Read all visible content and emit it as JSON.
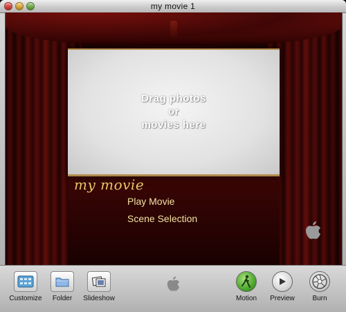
{
  "window": {
    "title": "my movie 1"
  },
  "stage": {
    "drop_zone_lines": [
      "Drag photos",
      "or",
      "movies here"
    ],
    "menu_title": "my movie",
    "menu_items": [
      "Play Movie",
      "Scene Selection"
    ]
  },
  "toolbar": {
    "buttons": [
      {
        "label": "Customize",
        "icon": "customize-icon"
      },
      {
        "label": "Folder",
        "icon": "folder-icon"
      },
      {
        "label": "Slideshow",
        "icon": "slideshow-icon"
      },
      {
        "label": "Motion",
        "icon": "motion-icon"
      },
      {
        "label": "Preview",
        "icon": "play-icon"
      },
      {
        "label": "Burn",
        "icon": "burn-icon"
      }
    ]
  },
  "colors": {
    "curtain": "#5e0d0a",
    "menu_title": "#e7c86a",
    "menu_text": "#f3e2a0",
    "motion_active": "#3e9d22"
  }
}
